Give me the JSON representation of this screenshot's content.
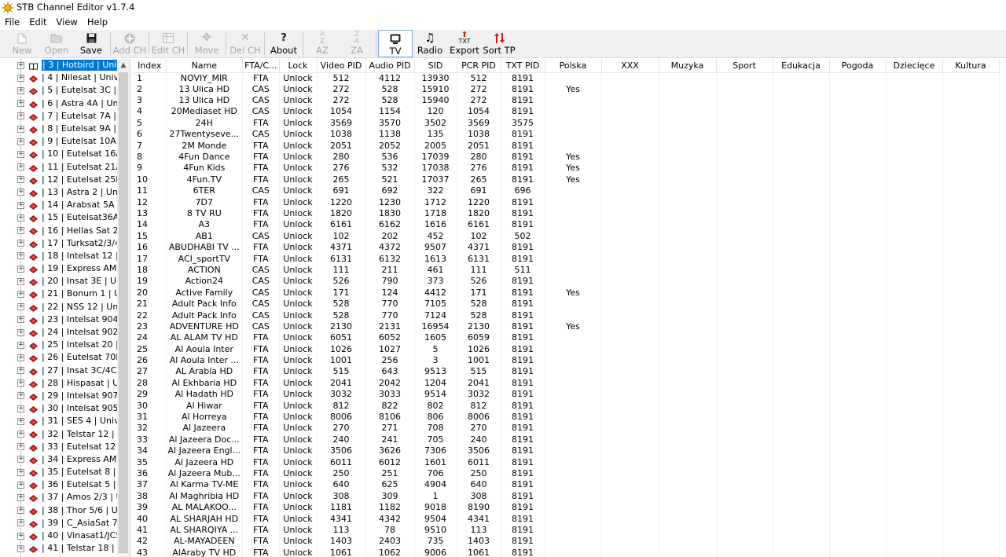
{
  "window": {
    "title": "STB Channel Editor v1.7.4"
  },
  "menu": [
    "File",
    "Edit",
    "View",
    "Help"
  ],
  "toolbar": {
    "new": "New",
    "open": "Open",
    "save": "Save",
    "add_ch": "Add CH",
    "edit_ch": "Edit CH",
    "move": "Move",
    "del_ch": "Del CH",
    "about": "About",
    "sort_az": "AZ",
    "sort_za": "ZA",
    "tv": "TV",
    "radio": "Radio",
    "export": "Export",
    "sort_tp": "Sort TP",
    "sort_az_small": "A",
    "sort_az_small2": "Z",
    "sort_za_small": "Z",
    "sort_za_small2": "A",
    "export_small": "TXT"
  },
  "tree": [
    "| 3 | Hotbird | Universal",
    "| 4 | Nilesat | Universal",
    "| 5 | Eutelsat 3C | Un",
    "| 6 | Astra 4A | Unive",
    "| 7 | Eutelsat 7A | Un",
    "| 8 | Eutelsat 9A | Un",
    "| 9 | Eutelsat 10A | Ur",
    "| 10 | Eutelsat 16A | U",
    "| 11 | Eutelsat 21A | U",
    "| 12 | Eutelsat 25B | U",
    "| 13 | Astra 2 | Univer",
    "| 14 | Arabsat 5A | Ur",
    "| 15 | Eutelsat36A/B",
    "| 16 | Hellas Sat 2 | U",
    "| 17 | Turksat2/3/4A",
    "| 18 | Intelsat 12 | Un",
    "| 19 | Express AM22",
    "| 20 | Insat 3E | Unive",
    "| 21 | Bonum 1 | Univ",
    "| 22 | NSS 12 | Univer",
    "| 23 | Intelsat 904 | U",
    "| 24 | Intelsat 902 | U",
    "| 25 | Intelsat 20 | Un",
    "| 26 | Eutelsat 70B | U",
    "| 27 | Insat 3C/4CR |",
    "| 28 | Hispasat | Univ",
    "| 29 | Intelsat 907 | U",
    "| 30 | Intelsat 905 | U",
    "| 31 | SES 4 | Univers",
    "| 32 | Telstar 12 | Uni",
    "| 33 | Eutelsat 12 | Ur",
    "| 34 | Express AM44",
    "| 35 | Eutelsat 8 | Uni",
    "| 36 | Eutelsat 5 | Uni",
    "| 37 | Amos 2/3 | Uni",
    "| 38 | Thor 5/6 | Univ",
    "| 39 | C_AsiaSat 7 | 0",
    "| 40 | Vinasat1/JCSA1",
    "| 41 | Telstar 18 | Uni"
  ],
  "columns": [
    "Index",
    "Name",
    "FTA/C...",
    "Lock",
    "Video PID",
    "Audio PID",
    "SID",
    "PCR PID",
    "TXT PID",
    "Polska",
    "XXX",
    "Muzyka",
    "Sport",
    "Edukacja",
    "Pogoda",
    "Dziecięce",
    "Kultura"
  ],
  "rows": [
    [
      "1",
      "NOVIY_MIR",
      "FTA",
      "Unlock",
      "512",
      "4112",
      "13930",
      "512",
      "8191",
      ""
    ],
    [
      "2",
      "13 Ulica HD",
      "CAS",
      "Unlock",
      "272",
      "528",
      "15910",
      "272",
      "8191",
      "Yes"
    ],
    [
      "3",
      "13 Ulica HD",
      "CAS",
      "Unlock",
      "272",
      "528",
      "15940",
      "272",
      "8191",
      ""
    ],
    [
      "4",
      "20Mediaset HD",
      "CAS",
      "Unlock",
      "1054",
      "1154",
      "120",
      "1054",
      "8191",
      ""
    ],
    [
      "5",
      "24H",
      "FTA",
      "Unlock",
      "3569",
      "3570",
      "3502",
      "3569",
      "3575",
      ""
    ],
    [
      "6",
      "27Twentyseve...",
      "CAS",
      "Unlock",
      "1038",
      "1138",
      "135",
      "1038",
      "8191",
      ""
    ],
    [
      "7",
      "2M Monde",
      "FTA",
      "Unlock",
      "2051",
      "2052",
      "2005",
      "2051",
      "8191",
      ""
    ],
    [
      "8",
      "4Fun Dance",
      "FTA",
      "Unlock",
      "280",
      "536",
      "17039",
      "280",
      "8191",
      "Yes"
    ],
    [
      "9",
      "4Fun Kids",
      "FTA",
      "Unlock",
      "276",
      "532",
      "17038",
      "276",
      "8191",
      "Yes"
    ],
    [
      "10",
      "4Fun.TV",
      "FTA",
      "Unlock",
      "265",
      "521",
      "17037",
      "265",
      "8191",
      "Yes"
    ],
    [
      "11",
      "6TER",
      "CAS",
      "Unlock",
      "691",
      "692",
      "322",
      "691",
      "696",
      ""
    ],
    [
      "12",
      "7D7",
      "FTA",
      "Unlock",
      "1220",
      "1230",
      "1712",
      "1220",
      "8191",
      ""
    ],
    [
      "13",
      "8 TV RU",
      "FTA",
      "Unlock",
      "1820",
      "1830",
      "1718",
      "1820",
      "8191",
      ""
    ],
    [
      "14",
      "A3",
      "FTA",
      "Unlock",
      "6161",
      "6162",
      "1616",
      "6161",
      "8191",
      ""
    ],
    [
      "15",
      "AB1",
      "CAS",
      "Unlock",
      "102",
      "202",
      "452",
      "102",
      "502",
      ""
    ],
    [
      "16",
      "ABUDHABI TV ...",
      "FTA",
      "Unlock",
      "4371",
      "4372",
      "9507",
      "4371",
      "8191",
      ""
    ],
    [
      "17",
      "ACI_sportTV",
      "FTA",
      "Unlock",
      "6131",
      "6132",
      "1613",
      "6131",
      "8191",
      ""
    ],
    [
      "18",
      "ACTION",
      "CAS",
      "Unlock",
      "111",
      "211",
      "461",
      "111",
      "511",
      ""
    ],
    [
      "19",
      "Action24",
      "CAS",
      "Unlock",
      "526",
      "790",
      "373",
      "526",
      "8191",
      ""
    ],
    [
      "20",
      "Active Family",
      "CAS",
      "Unlock",
      "171",
      "124",
      "4412",
      "171",
      "8191",
      "Yes"
    ],
    [
      "21",
      "Adult Pack Info",
      "CAS",
      "Unlock",
      "528",
      "770",
      "7105",
      "528",
      "8191",
      ""
    ],
    [
      "22",
      "Adult Pack Info",
      "CAS",
      "Unlock",
      "528",
      "770",
      "7124",
      "528",
      "8191",
      ""
    ],
    [
      "23",
      "ADVENTURE HD",
      "CAS",
      "Unlock",
      "2130",
      "2131",
      "16954",
      "2130",
      "8191",
      "Yes"
    ],
    [
      "24",
      "AL ALAM TV HD",
      "FTA",
      "Unlock",
      "6051",
      "6052",
      "1605",
      "6059",
      "8191",
      ""
    ],
    [
      "25",
      "Al Aoula Inter",
      "FTA",
      "Unlock",
      "1026",
      "1027",
      "5",
      "1026",
      "8191",
      ""
    ],
    [
      "26",
      "Al Aoula Inter ...",
      "FTA",
      "Unlock",
      "1001",
      "256",
      "3",
      "1001",
      "8191",
      ""
    ],
    [
      "27",
      "AL Arabia HD",
      "FTA",
      "Unlock",
      "515",
      "643",
      "9513",
      "515",
      "8191",
      ""
    ],
    [
      "28",
      "Al Ekhbaria HD",
      "FTA",
      "Unlock",
      "2041",
      "2042",
      "1204",
      "2041",
      "8191",
      ""
    ],
    [
      "29",
      "Al Hadath HD",
      "FTA",
      "Unlock",
      "3032",
      "3033",
      "9514",
      "3032",
      "8191",
      ""
    ],
    [
      "30",
      "Al Hiwar",
      "FTA",
      "Unlock",
      "812",
      "822",
      "802",
      "812",
      "8191",
      ""
    ],
    [
      "31",
      "Al Horreya",
      "FTA",
      "Unlock",
      "8006",
      "8106",
      "806",
      "8006",
      "8191",
      ""
    ],
    [
      "32",
      "Al Jazeera",
      "FTA",
      "Unlock",
      "270",
      "271",
      "708",
      "270",
      "8191",
      ""
    ],
    [
      "33",
      "Al Jazeera Doc...",
      "FTA",
      "Unlock",
      "240",
      "241",
      "705",
      "240",
      "8191",
      ""
    ],
    [
      "34",
      "Al Jazeera Engl...",
      "FTA",
      "Unlock",
      "3506",
      "3626",
      "7306",
      "3506",
      "8191",
      ""
    ],
    [
      "35",
      "Al Jazeera HD",
      "FTA",
      "Unlock",
      "6011",
      "6012",
      "1601",
      "6011",
      "8191",
      ""
    ],
    [
      "36",
      "Al Jazeera Mub...",
      "FTA",
      "Unlock",
      "250",
      "251",
      "706",
      "250",
      "8191",
      ""
    ],
    [
      "37",
      "Al Karma TV-ME",
      "FTA",
      "Unlock",
      "640",
      "625",
      "4904",
      "640",
      "8191",
      ""
    ],
    [
      "38",
      "Al Maghribia HD",
      "FTA",
      "Unlock",
      "308",
      "309",
      "1",
      "308",
      "8191",
      ""
    ],
    [
      "39",
      "AL MALAKOO...",
      "FTA",
      "Unlock",
      "1181",
      "1182",
      "9018",
      "8190",
      "8191",
      ""
    ],
    [
      "40",
      "AL SHARJAH HD",
      "FTA",
      "Unlock",
      "4341",
      "4342",
      "9504",
      "4341",
      "8191",
      ""
    ],
    [
      "41",
      "AL SHARQIYA ...",
      "FTA",
      "Unlock",
      "113",
      "78",
      "9510",
      "113",
      "8191",
      ""
    ],
    [
      "42",
      "AL-MAYADEEN",
      "FTA",
      "Unlock",
      "1403",
      "2403",
      "735",
      "1403",
      "8191",
      ""
    ],
    [
      "43",
      "AlAraby TV HD",
      "FTA",
      "Unlock",
      "1061",
      "1062",
      "9006",
      "1061",
      "8191",
      ""
    ]
  ]
}
